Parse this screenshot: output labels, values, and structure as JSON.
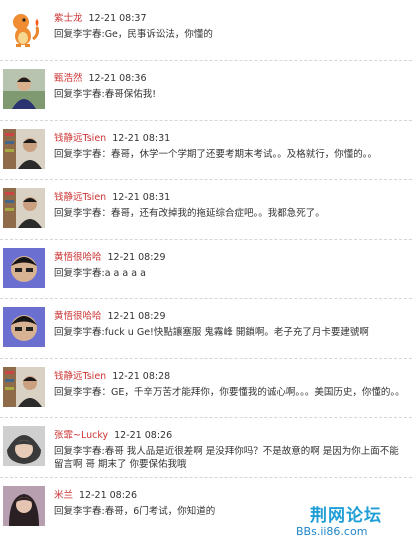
{
  "comments": [
    {
      "user": "紫士龙",
      "time": "12-21 08:37",
      "text": "回复李宇春:Ge，民事诉讼法，你懂的"
    },
    {
      "user": "甄浩然",
      "time": "12-21 08:36",
      "text": "回复李宇春:春哥保佑我!"
    },
    {
      "user": "钱静远Tsien",
      "time": "12-21 08:31",
      "text": "回复李宇春：春哥，休学一个学期了还要考期末考试。。及格就行，你懂的。。"
    },
    {
      "user": "钱静远Tsien",
      "time": "12-21 08:31",
      "text": "回复李宇春：春哥，还有改掉我的拖延综合症吧。。我都急死了。"
    },
    {
      "user": "黄悟很哈哈",
      "time": "12-21 08:29",
      "text": "回复李宇春:a a a a a"
    },
    {
      "user": "黄悟很哈哈",
      "time": "12-21 08:29",
      "text": "回复李宇春:fuck u Ge!快點讓塞服 鬼霧峰 開鎖啊。老子充了月卡要建號啊"
    },
    {
      "user": "钱静远Tsien",
      "time": "12-21 08:28",
      "text": "回复李宇春：GE，千辛万苦才能拜你，你要懂我的诚心啊。。。美国历史，你懂的。。"
    },
    {
      "user": "张霏~Lucky",
      "time": "12-21 08:26",
      "text": "回复李宇春:春哥 我人品是近很差啊 是没拜你吗？不是故意的啊 是因为你上面不能留言啊 哥 期末了 你要保佑我哦"
    },
    {
      "user": "米兰",
      "time": "12-21 08:26",
      "text": "回复李宇春:春哥，6门考试，你知道的"
    }
  ],
  "watermark": {
    "title": "荆网论坛",
    "url": "BBs.ii86.com"
  }
}
